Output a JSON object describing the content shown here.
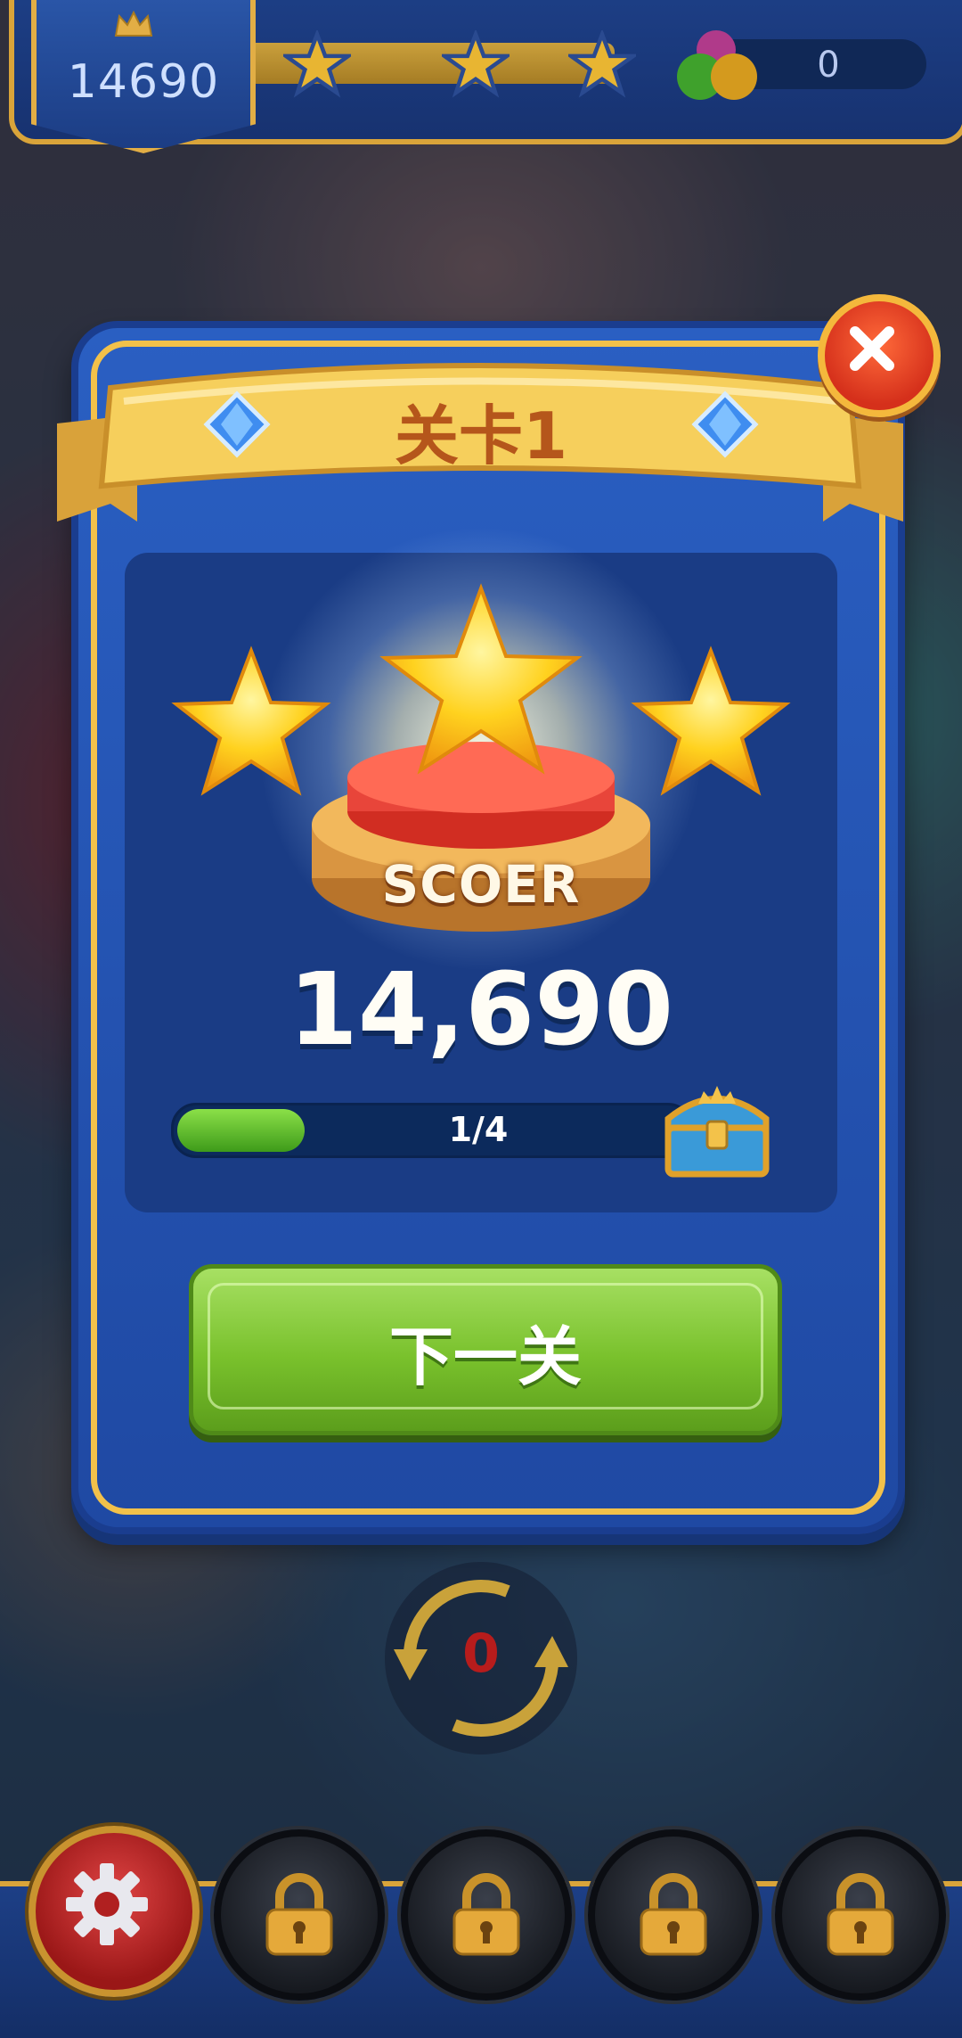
{
  "hud": {
    "score": "14690",
    "star_count": 3,
    "orb_count": "0"
  },
  "dialog": {
    "title": "关卡1",
    "stars_earned": 3,
    "podium_label": "SCOER",
    "score": "14,690",
    "chest_progress_label": "1/4",
    "chest_progress_fraction": 0.25,
    "next_button_label": "下一关"
  },
  "swap": {
    "count": "0"
  },
  "bottom_bar": {
    "slots": [
      {
        "icon": "gear-icon",
        "locked": false
      },
      {
        "icon": "lock-icon",
        "locked": true
      },
      {
        "icon": "lock-icon",
        "locked": true
      },
      {
        "icon": "lock-icon",
        "locked": true
      },
      {
        "icon": "lock-icon",
        "locked": true
      }
    ]
  },
  "colors": {
    "dialog_blue": "#2a5fc2",
    "gold": "#f2c14a",
    "next_button_green": "#79c12c",
    "close_red": "#d5301b"
  }
}
